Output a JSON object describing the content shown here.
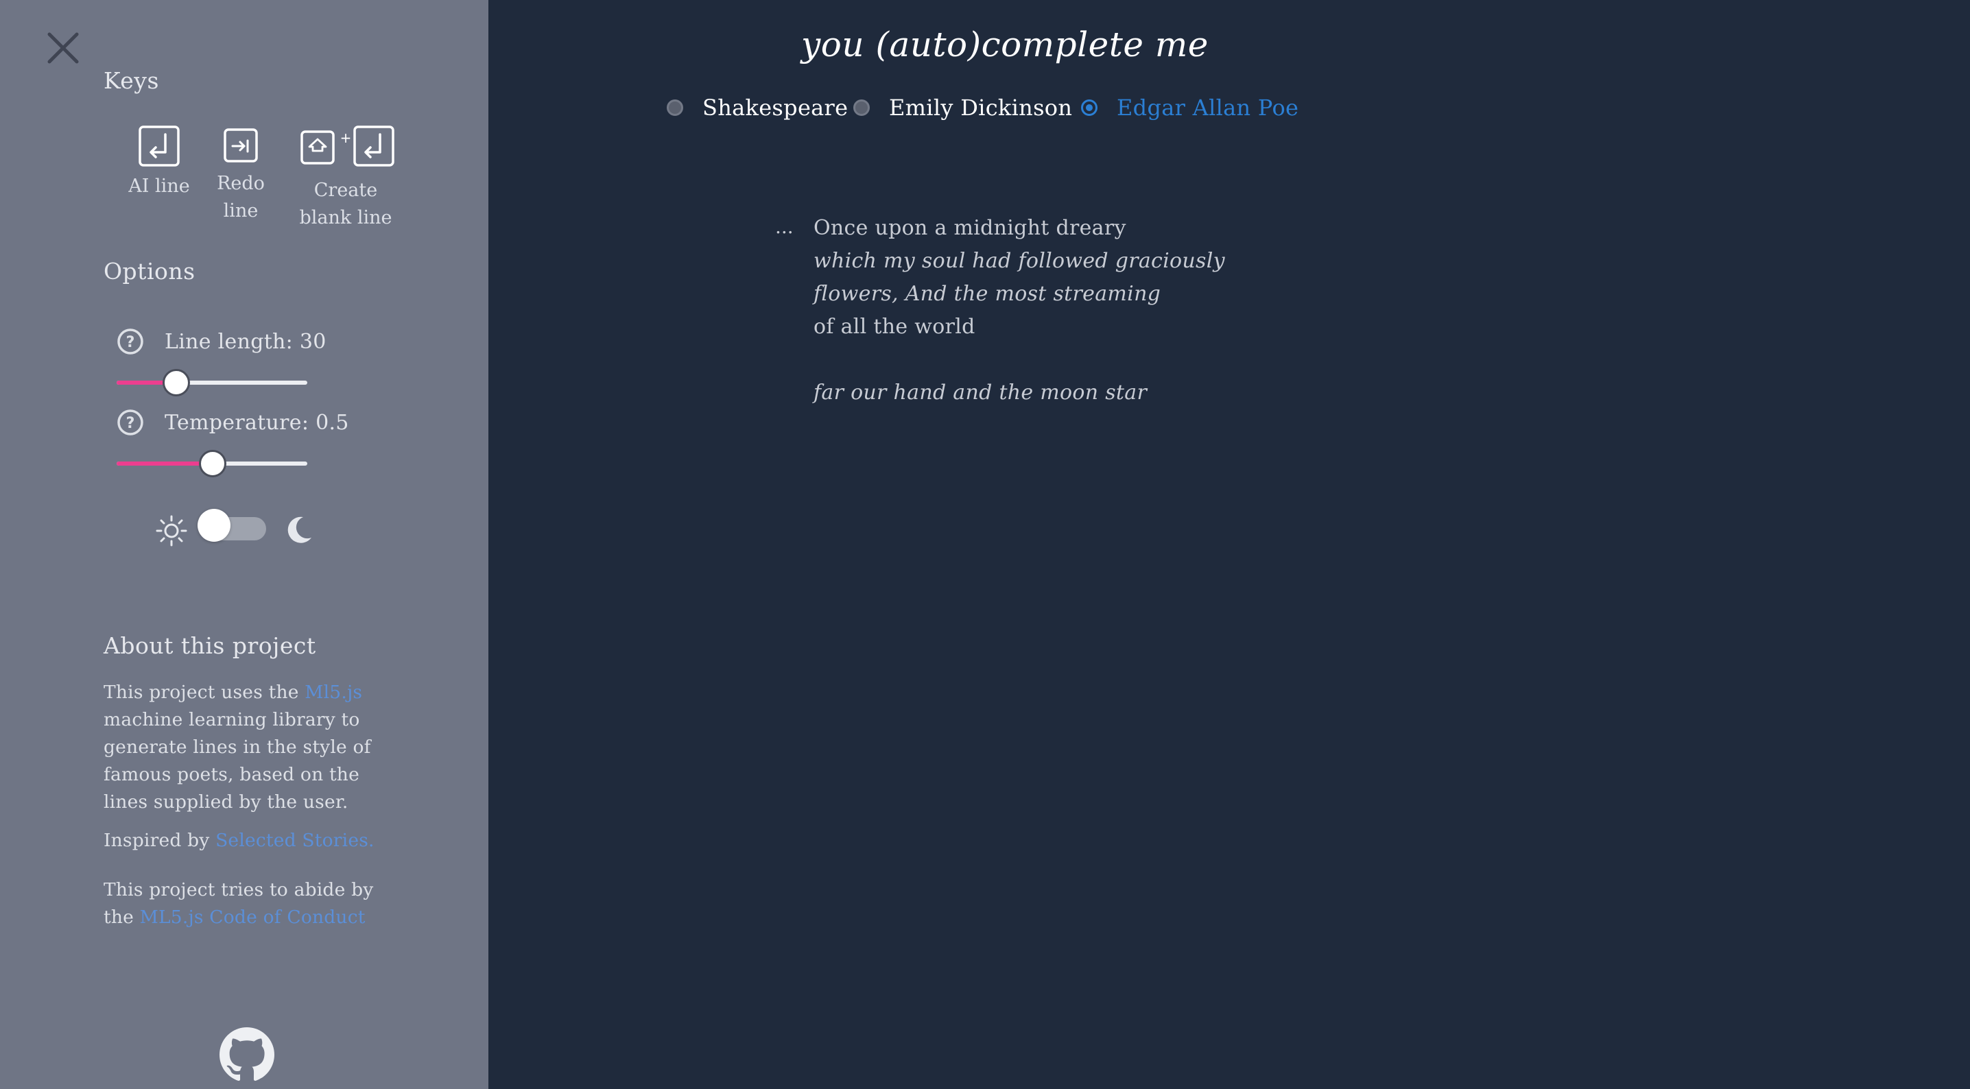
{
  "colors": {
    "sidebar_bg": "#6f7585",
    "main_bg": "#1f2a3c",
    "accent_blue": "#2b7fd4",
    "slider_pink": "#ec3e8f",
    "link_blue": "#5b8fd8"
  },
  "sidebar": {
    "close_icon": "close-icon",
    "keys": {
      "title": "Keys",
      "items": [
        {
          "icon": "enter-key-icon",
          "label_lines": [
            "AI line"
          ]
        },
        {
          "icon": "tab-key-icon",
          "label_lines": [
            "Redo",
            "line"
          ]
        },
        {
          "icon": "shift-enter-keys-icon",
          "plus": "+",
          "label_lines": [
            "Create",
            "blank line"
          ]
        }
      ]
    },
    "options": {
      "title": "Options",
      "line_length": {
        "label": "Line length: 30",
        "value": 30,
        "fraction": 0.31
      },
      "temperature": {
        "label": "Temperature: 0.5",
        "value": 0.5,
        "fraction": 0.5
      },
      "theme": {
        "sun_icon": "sun-icon",
        "moon_icon": "moon-icon",
        "dark_mode": false
      }
    },
    "about": {
      "title": "About this project",
      "p1_before": "This project uses the ",
      "p1_link": "Ml5.js",
      "p1_after": " machine learning library to generate lines in the style of famous poets, based on the lines supplied by the user.",
      "p2_before": "Inspired by ",
      "p2_link": "Selected Stories.",
      "p3_before": "This project tries to abide by the ",
      "p3_link": "ML5.js Code of Conduct"
    },
    "github_icon": "github-icon"
  },
  "main": {
    "title": "you (auto)complete me",
    "poets": [
      {
        "label": "Shakespeare",
        "selected": false
      },
      {
        "label": "Emily Dickinson",
        "selected": false
      },
      {
        "label": "Edgar Allan Poe",
        "selected": true
      }
    ],
    "ellipsis": "...",
    "poem": [
      {
        "text": "Once upon a midnight dreary",
        "ai": false
      },
      {
        "text": "which my soul had followed graciously",
        "ai": true
      },
      {
        "text": "flowers, And the most streaming",
        "ai": true
      },
      {
        "text": "of all the world",
        "ai": false
      },
      {
        "text": "",
        "ai": false
      },
      {
        "text": "far our hand and the moon star",
        "ai": true
      }
    ]
  }
}
